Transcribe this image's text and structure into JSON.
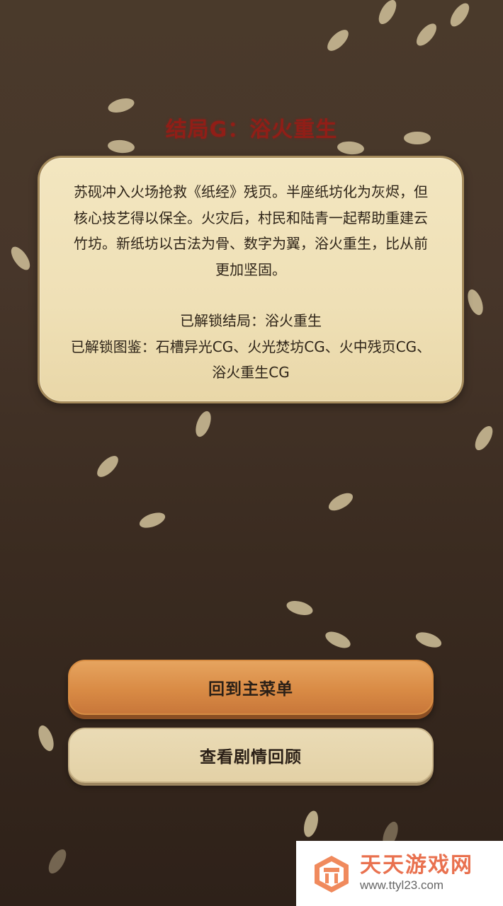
{
  "ending": {
    "title": "结局G：浴火重生"
  },
  "story": {
    "text": "苏砚冲入火场抢救《纸经》残页。半座纸坊化为灰烬，但核心技艺得以保全。火灾后，村民和陆青一起帮助重建云竹坊。新纸坊以古法为骨、数字为翼，浴火重生，比从前更加坚固。",
    "unlocked_ending": "已解锁结局：浴火重生",
    "unlocked_gallery": "已解锁图鉴：石槽异光CG、火光焚坊CG、火中残页CG、浴火重生CG"
  },
  "buttons": {
    "main_menu": "回到主菜单",
    "review": "查看剧情回顾"
  },
  "watermark": {
    "name": "天天游戏网",
    "url": "www.ttyl23.com"
  },
  "colors": {
    "background": "#47362a",
    "title_red": "#9e1a14",
    "card": "#efe0b6",
    "primary_button": "#d98b45",
    "secondary_button": "#e3d1a6",
    "watermark_orange": "#e9714f"
  }
}
